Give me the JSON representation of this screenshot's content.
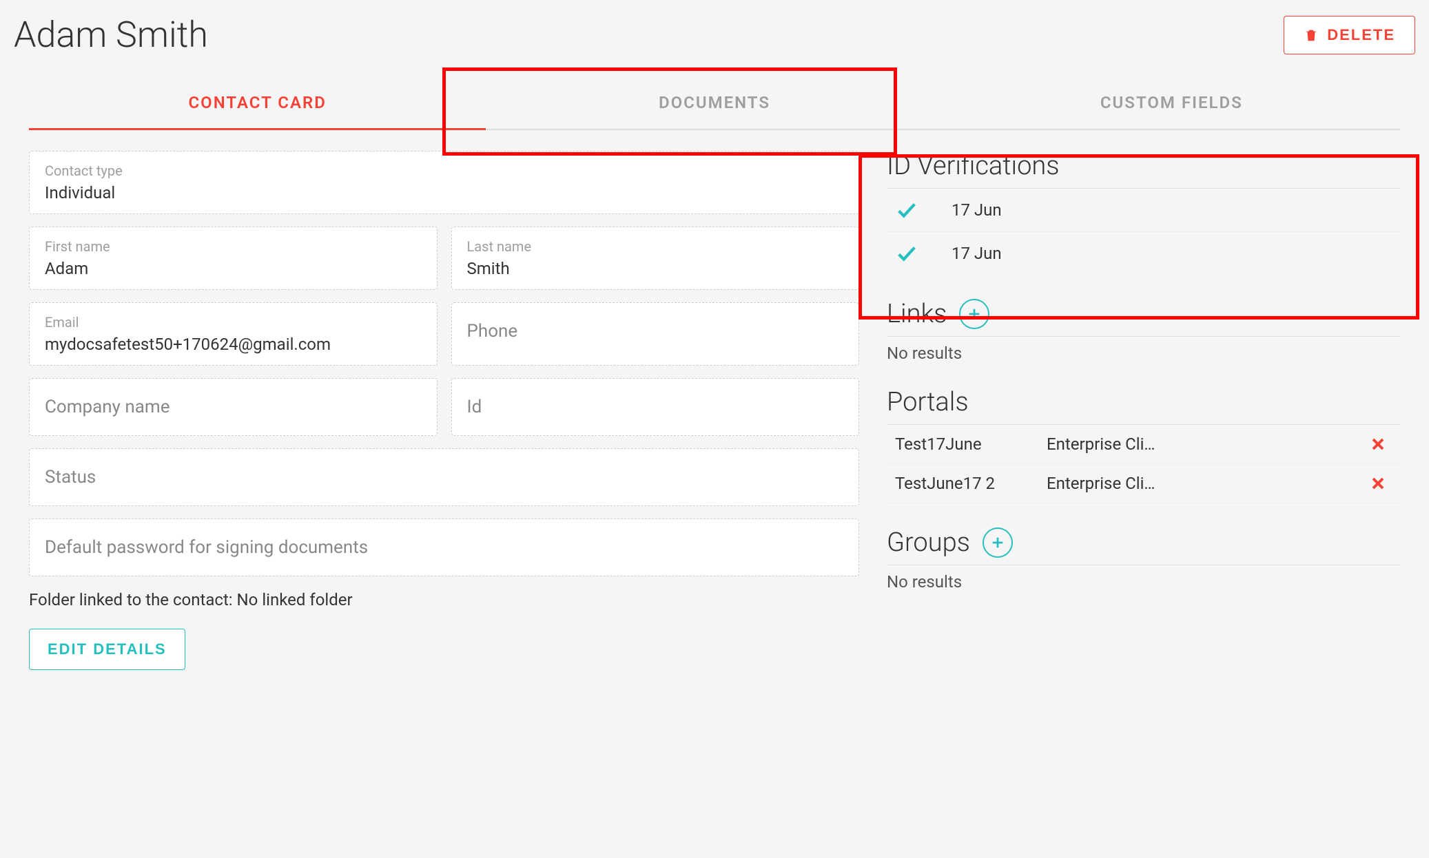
{
  "header": {
    "title": "Adam Smith",
    "delete_label": "DELETE"
  },
  "tabs": {
    "contact_card": "CONTACT CARD",
    "documents": "DOCUMENTS",
    "custom_fields": "CUSTOM FIELDS"
  },
  "fields": {
    "contact_type": {
      "label": "Contact type",
      "value": "Individual"
    },
    "first_name": {
      "label": "First name",
      "value": "Adam"
    },
    "last_name": {
      "label": "Last name",
      "value": "Smith"
    },
    "email": {
      "label": "Email",
      "value": "mydocsafetest50+170624@gmail.com"
    },
    "phone": {
      "label": "Phone",
      "value": ""
    },
    "company_name": {
      "label": "Company name",
      "value": ""
    },
    "id": {
      "label": "Id",
      "value": ""
    },
    "status": {
      "label": "Status",
      "value": ""
    },
    "default_password": {
      "label": "Default password for signing documents",
      "value": ""
    }
  },
  "folder_linked_text": "Folder linked to the contact: No linked folder",
  "edit_details_label": "EDIT DETAILS",
  "sidebar": {
    "id_verifications": {
      "title": "ID Verifications",
      "items": [
        {
          "date": "17 Jun"
        },
        {
          "date": "17 Jun"
        }
      ]
    },
    "links": {
      "title": "Links",
      "no_results": "No results"
    },
    "portals": {
      "title": "Portals",
      "items": [
        {
          "name": "Test17June",
          "plan": "Enterprise Cli…"
        },
        {
          "name": "TestJune17 2",
          "plan": "Enterprise Cli…"
        }
      ]
    },
    "groups": {
      "title": "Groups",
      "no_results": "No results"
    }
  }
}
